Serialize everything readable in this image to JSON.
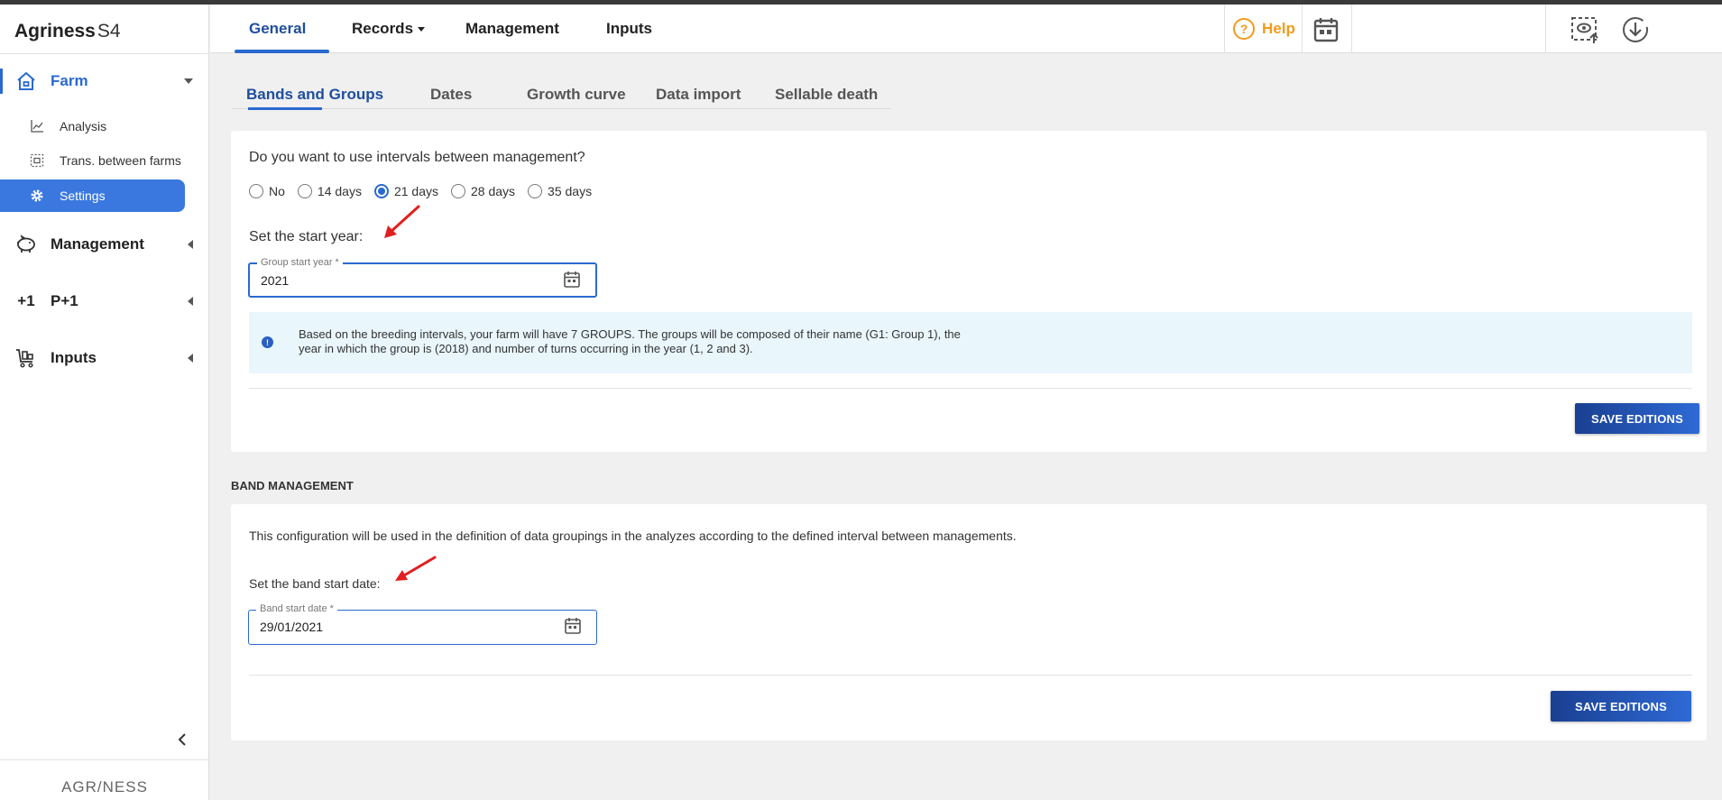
{
  "app": {
    "name": "Agriness",
    "edition": "S4",
    "footer_brand": "AGR/NESS"
  },
  "sidebar": {
    "sections": [
      {
        "label": "Farm",
        "icon": "home-icon"
      },
      {
        "label": "Management",
        "icon": "pig-icon"
      },
      {
        "label": "P+1",
        "icon": "plus-one-icon"
      },
      {
        "label": "Inputs",
        "icon": "cart-icon"
      }
    ],
    "farm_items": [
      {
        "label": "Analysis",
        "icon": "chart-line-icon"
      },
      {
        "label": "Trans. between farms",
        "icon": "transfer-icon"
      },
      {
        "label": "Settings",
        "icon": "gear-icon"
      }
    ]
  },
  "topnav": {
    "tabs": [
      "General",
      "Records",
      "Management",
      "Inputs"
    ],
    "help_label": "Help"
  },
  "content_tabs": [
    "Bands and Groups",
    "Dates",
    "Growth curve",
    "Data import",
    "Sellable death"
  ],
  "intervals": {
    "question": "Do you want to use intervals between management?",
    "options": [
      "No",
      "14 days",
      "21 days",
      "28 days",
      "35 days"
    ],
    "selected": "21 days"
  },
  "start_year": {
    "prompt": "Set the start year:",
    "field_label": "Group start year *",
    "value": "2021"
  },
  "info_message": "Based on the breeding intervals, your farm will have 7 GROUPS. The groups will be composed of their name (G1: Group 1), the year in which the group is (2018) and number of turns occurring in the year (1, 2 and 3).",
  "save_label": "SAVE EDITIONS",
  "band_management": {
    "title": "BAND MANAGEMENT",
    "description": "This configuration will be used in the definition of data groupings in the analyzes according to the defined interval between managements.",
    "prompt": "Set the band start date:",
    "field_label": "Band start date *",
    "value": "29/01/2021"
  },
  "colors": {
    "accent": "#2a6ad0",
    "help": "#f39a1d",
    "info_bg": "#e9f6fc",
    "annotation": "#e02020"
  }
}
